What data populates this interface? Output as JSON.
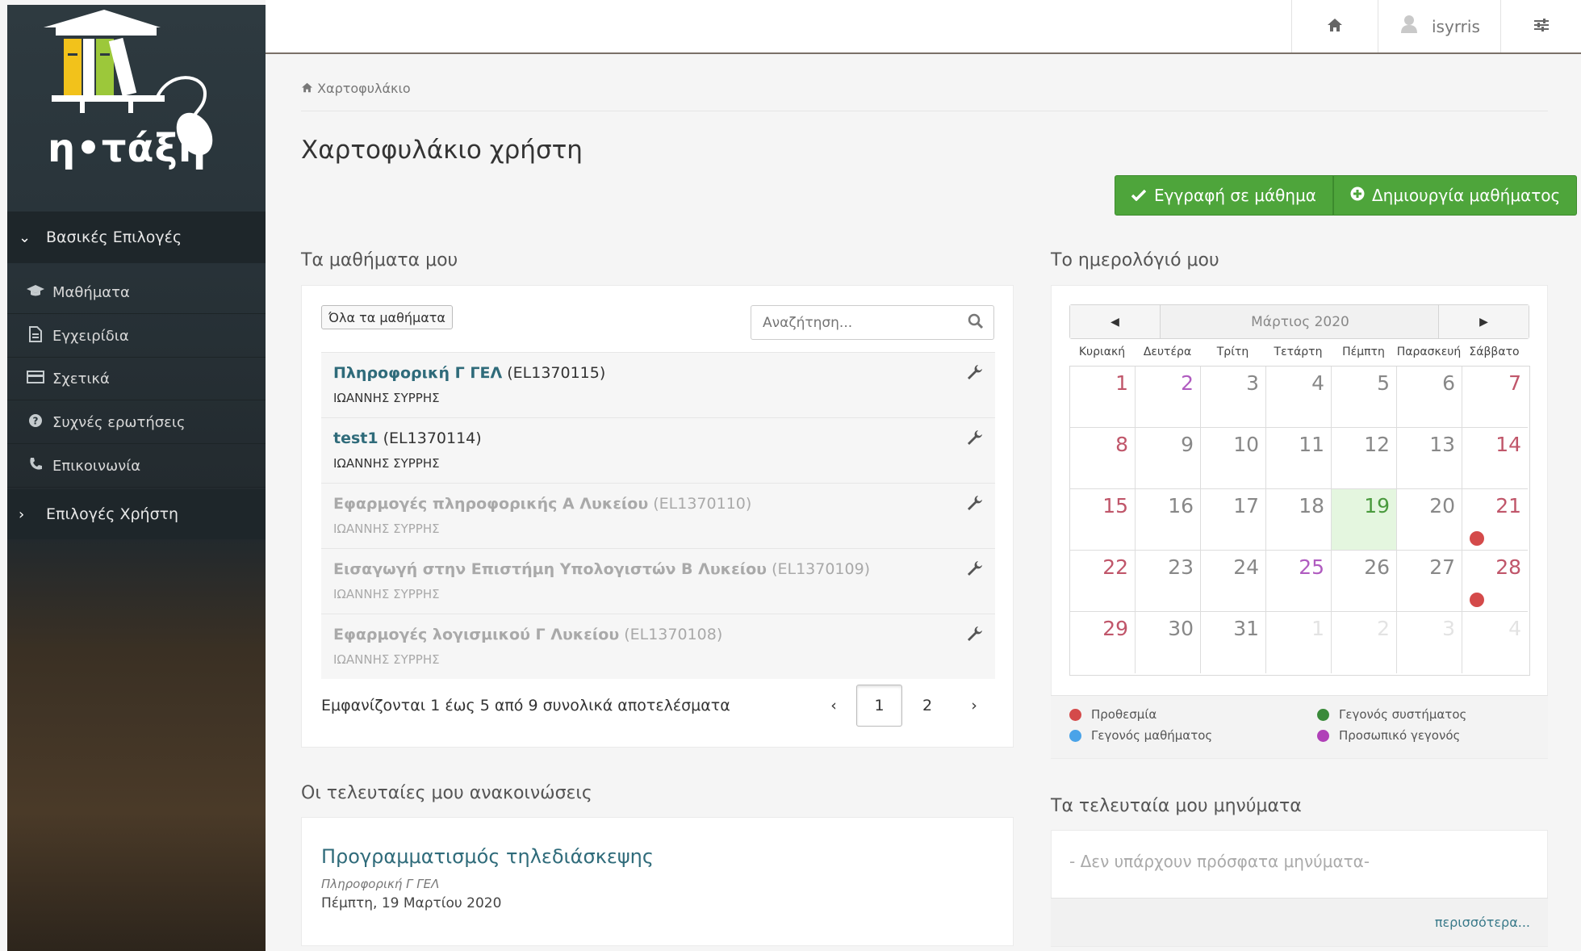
{
  "app": {
    "logo_text": "η•τάξη"
  },
  "sidebar": {
    "group_basic": "Βασικές Επιλογές",
    "items": [
      {
        "label": "Μαθήματα",
        "icon": "graduation-cap-icon"
      },
      {
        "label": "Εγχειρίδια",
        "icon": "file-text-icon"
      },
      {
        "label": "Σχετικά",
        "icon": "credit-card-icon"
      },
      {
        "label": "Συχνές ερωτήσεις",
        "icon": "question-circle-icon"
      },
      {
        "label": "Επικοινωνία",
        "icon": "phone-icon"
      }
    ],
    "group_user": "Επιλογές Χρήστη"
  },
  "topbar": {
    "username": "isyrris"
  },
  "breadcrumb": {
    "label": "Χαρτοφυλάκιο"
  },
  "page": {
    "title": "Χαρτοφυλάκιο χρήστη",
    "btn_register": "Εγγραφή σε μάθημα",
    "btn_create": "Δημιουργία μαθήματος"
  },
  "courses": {
    "section_title": "Τα μαθήματα μου",
    "all_button": "Όλα τα μαθήματα",
    "search_placeholder": "Αναζήτηση...",
    "rows": [
      {
        "title": "Πληροφορική Γ ΓΕΛ",
        "code": "(EL1370115)",
        "professor": "ΙΩΑΝΝΗΣ ΣΥΡΡΗΣ",
        "active": true
      },
      {
        "title": "test1",
        "code": "(EL1370114)",
        "professor": "ΙΩΑΝΝΗΣ ΣΥΡΡΗΣ",
        "active": true
      },
      {
        "title": "Εφαρμογές πληροφορικής Α Λυκείου",
        "code": "(EL1370110)",
        "professor": "ΙΩΑΝΝΗΣ ΣΥΡΡΗΣ",
        "active": false
      },
      {
        "title": "Εισαγωγή στην Επιστήμη Υπολογιστών Β Λυκείου",
        "code": "(EL1370109)",
        "professor": "ΙΩΑΝΝΗΣ ΣΥΡΡΗΣ",
        "active": false
      },
      {
        "title": "Εφαρμογές λογισμικού Γ Λυκείου",
        "code": "(EL1370108)",
        "professor": "ΙΩΑΝΝΗΣ ΣΥΡΡΗΣ",
        "active": false
      }
    ],
    "results_text": "Εμφανίζονται 1 έως 5 από 9 συνολικά αποτελέσματα",
    "pager": {
      "prev": "‹",
      "current": "1",
      "next_page": "2",
      "next": "›"
    }
  },
  "calendar": {
    "section_title": "Το ημερολόγιό μου",
    "month": "Μάρτιος 2020",
    "weekdays": [
      "Κυριακή",
      "Δευτέρα",
      "Τρίτη",
      "Τετάρτη",
      "Πέμπτη",
      "Παρασκευή",
      "Σάββατο"
    ],
    "weeks": [
      [
        "1",
        "2",
        "3",
        "4",
        "5",
        "6",
        "7"
      ],
      [
        "8",
        "9",
        "10",
        "11",
        "12",
        "13",
        "14"
      ],
      [
        "15",
        "16",
        "17",
        "18",
        "19",
        "20",
        "21"
      ],
      [
        "22",
        "23",
        "24",
        "25",
        "26",
        "27",
        "28"
      ],
      [
        "29",
        "30",
        "31",
        "1",
        "2",
        "3",
        "4"
      ]
    ],
    "legend": {
      "deadline": "Προθεσμία",
      "course_event": "Γεγονός μαθήματος",
      "system_event": "Γεγονός συστήματος",
      "personal_event": "Προσωπικό γεγονός"
    },
    "colors": {
      "deadline": "#d44a4a",
      "course_event": "#4aa3e8",
      "system_event": "#3a8a3a",
      "personal_event": "#b040b8",
      "today": "#e4f6df"
    }
  },
  "announcements": {
    "section_title": "Οι τελευταίες μου ανακοινώσεις",
    "item_title": "Προγραμματισμός τηλεδιάσκεψης",
    "item_course": "Πληροφορική Γ ΓΕΛ",
    "item_date": "Πέμπτη, 19 Μαρτίου 2020"
  },
  "messages": {
    "section_title": "Τα τελευταία μου μηνύματα",
    "empty_text": "- Δεν υπάρχουν πρόσφατα μηνύματα-",
    "more_link": "περισσότερα..."
  },
  "colors": {
    "accent_green": "#4ea53b",
    "link_teal": "#2f6b7a"
  }
}
